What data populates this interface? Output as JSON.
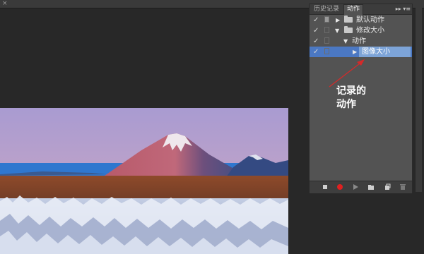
{
  "app": {
    "close_glyph": "×"
  },
  "panel": {
    "tabs": [
      {
        "label": "历史记录",
        "active": false
      },
      {
        "label": "动作",
        "active": true
      }
    ],
    "menu_glyph": "▸▸ ▾≡",
    "items": [
      {
        "checked": true,
        "indent": 0,
        "type": "set",
        "expanded": false,
        "label": "默认动作"
      },
      {
        "checked": true,
        "indent": 0,
        "type": "set",
        "expanded": true,
        "label": "修改大小"
      },
      {
        "checked": true,
        "indent": 1,
        "type": "action",
        "expanded": true,
        "label": "动作"
      },
      {
        "checked": true,
        "indent": 2,
        "type": "step",
        "expanded": false,
        "label": "图像大小",
        "selected": true
      }
    ],
    "bottom_buttons": [
      "stop-button",
      "record-button",
      "play-button",
      "new-set-button",
      "new-action-button",
      "delete-button"
    ]
  },
  "annotation": {
    "line1": "记录的",
    "line2": "动作",
    "color": "#ffffff",
    "arrow_color": "#d42a2a"
  },
  "colors": {
    "panel_bg": "#535353",
    "selection": "#4b78c3",
    "record": "#e02020"
  }
}
